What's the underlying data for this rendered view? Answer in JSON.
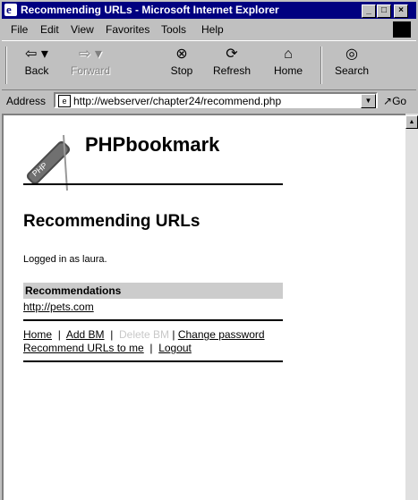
{
  "window": {
    "title": "Recommending URLs - Microsoft Internet Explorer",
    "minimize": "_",
    "maximize": "□",
    "close": "×"
  },
  "menu": [
    "File",
    "Edit",
    "View",
    "Favorites",
    "Tools",
    "Help"
  ],
  "toolbar": {
    "back": "Back",
    "forward": "Forward",
    "stop": "Stop",
    "refresh": "Refresh",
    "home": "Home",
    "search": "Search"
  },
  "address": {
    "label": "Address",
    "url": "http://webserver/chapter24/recommend.php",
    "go": "Go"
  },
  "page": {
    "brand": "PHPbookmark",
    "logo_text": "PHP",
    "heading": "Recommending URLs",
    "logged_in": "Logged in as laura.",
    "recommendations_header": "Recommendations",
    "recommended_url": "http://pets.com",
    "nav": {
      "home": "Home",
      "add_bm": "Add BM",
      "delete_bm": "Delete BM",
      "change_password": "Change password",
      "recommend": "Recommend URLs to me",
      "logout": "Logout",
      "sep": "|"
    }
  }
}
